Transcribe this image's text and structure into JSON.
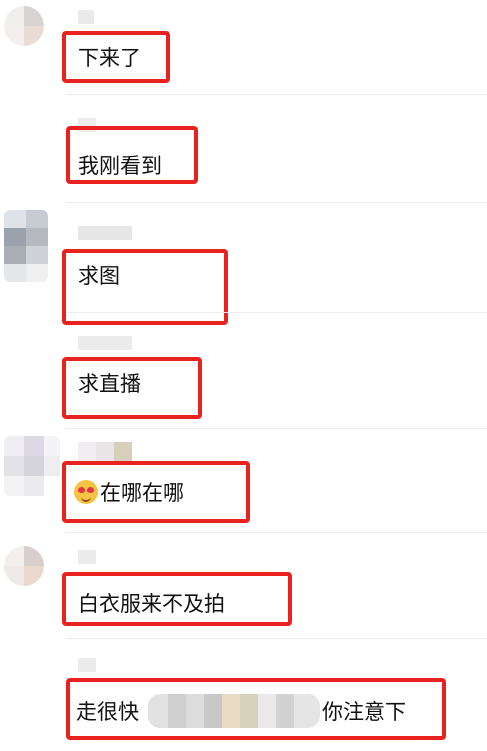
{
  "comments": [
    {
      "text": "下来了"
    },
    {
      "text": "我刚看到"
    },
    {
      "text": "求图"
    },
    {
      "text": "求直播"
    },
    {
      "emoji": "heart-eyes-emoji",
      "text": "在哪在哪"
    },
    {
      "text": "白衣服来不及拍"
    },
    {
      "text_before": "走很快",
      "text_after": "你注意下"
    }
  ],
  "colors": {
    "highlight": "#e8231f",
    "divider": "#ececec",
    "text": "#111111"
  }
}
